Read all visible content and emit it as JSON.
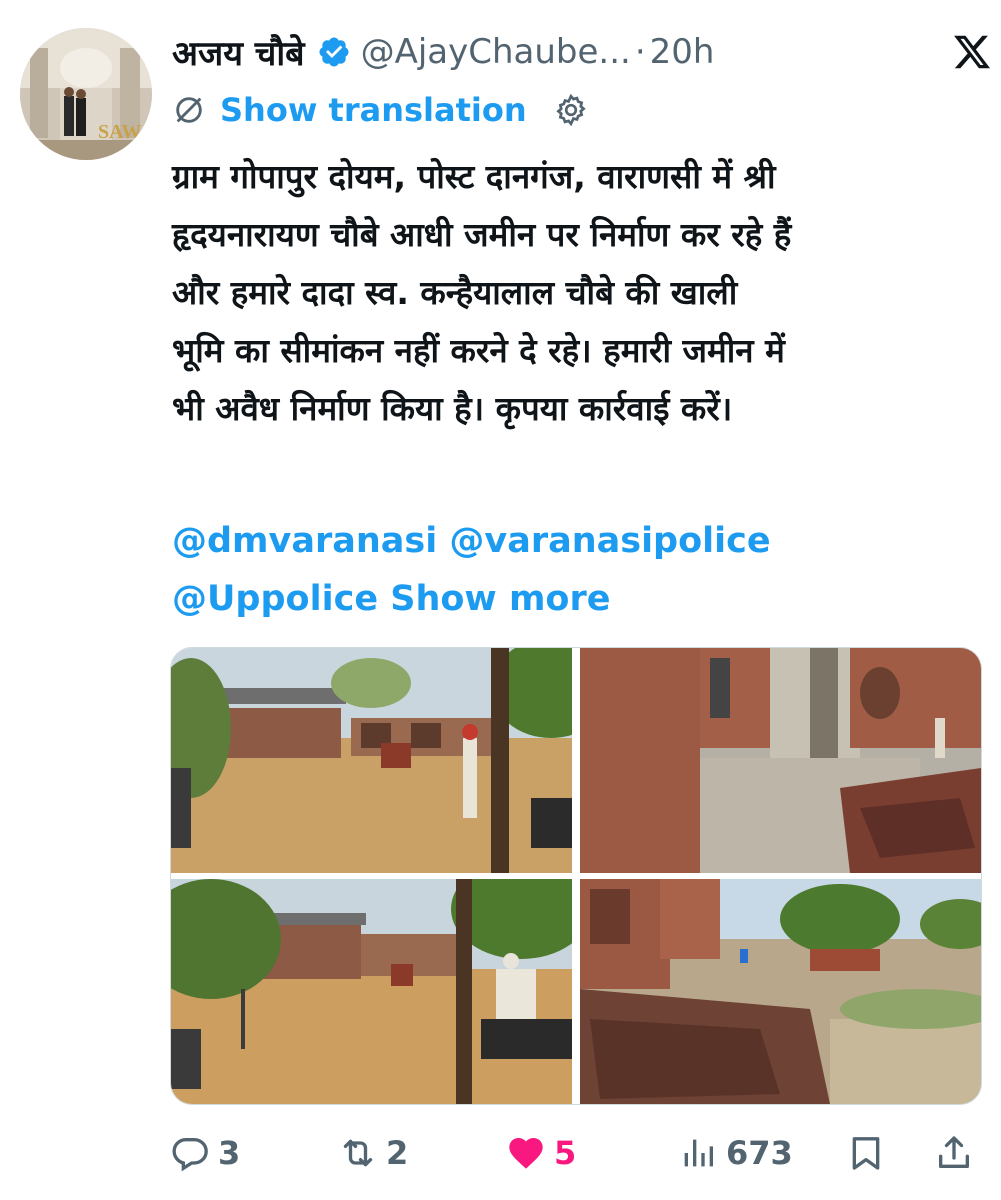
{
  "tweet": {
    "author_name": "अजय चौबे",
    "handle": "@AjayChaube...",
    "separator": "·",
    "time": "20h",
    "translate_label": "Show translation",
    "text_lines": [
      "ग्राम गोपापुर दोयम, पोस्ट दानगंज, वाराणसी में श्री",
      "हृदयनारायण चौबे आधी जमीन पर निर्माण कर रहे हैं",
      "और हमारे दादा स्व. कन्हैयालाल चौबे की खाली",
      "भूमि का सीमांकन नहीं करने दे रहे। हमारी जमीन में",
      "भी अवैध निर्माण किया है। कृपया कार्रवाई करें।"
    ],
    "mentions_line1": "@dmvaranasi @varanasipolice",
    "mentions_line2": "@Uppolice",
    "show_more_label": "Show more",
    "avatar_sign": "SAWA"
  },
  "actions": {
    "replies": "3",
    "reposts": "2",
    "likes": "5",
    "views": "673"
  },
  "icons": {
    "verified": "verified-badge-icon",
    "logo": "x-logo-icon",
    "translate": "translate-globe-icon",
    "settings": "gear-icon",
    "reply": "reply-icon",
    "repost": "repost-icon",
    "like": "heart-icon",
    "views": "views-icon",
    "bookmark": "bookmark-icon",
    "share": "share-icon"
  },
  "colors": {
    "accent": "#1d9bf0",
    "text": "#0f1419",
    "secondary": "#536471",
    "like": "#f91880"
  }
}
